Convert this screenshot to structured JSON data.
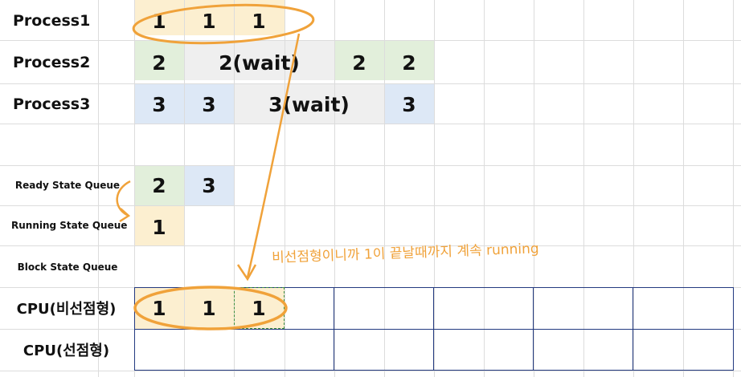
{
  "rows": {
    "process1": {
      "label": "Process1",
      "cells": [
        "1",
        "1",
        "1"
      ]
    },
    "process2": {
      "label": "Process2",
      "cells": [
        "2",
        "2(wait)",
        "2",
        "2"
      ]
    },
    "process3": {
      "label": "Process3",
      "cells": [
        "3",
        "3",
        "3(wait)",
        "3"
      ]
    },
    "ready_queue": {
      "label": "Ready State Queue",
      "cells": [
        "2",
        "3"
      ]
    },
    "running_queue": {
      "label": "Running State Queue",
      "cells": [
        "1"
      ]
    },
    "block_queue": {
      "label": "Block State Queue"
    },
    "cpu_nonpreemptive": {
      "label": "CPU(비선점형)",
      "cells": [
        "1",
        "1",
        "1"
      ]
    },
    "cpu_preemptive": {
      "label": "CPU(선점형)"
    }
  },
  "annotation": {
    "note": "비선점형이니까 1이 끝날때까지 계속 running"
  },
  "colors": {
    "process1": "#fcefd0",
    "process2": "#e2efdb",
    "process3": "#dde8f6",
    "wait": "#efefef",
    "annotation": "#f0a23a",
    "cpu_border": "#233a80"
  }
}
